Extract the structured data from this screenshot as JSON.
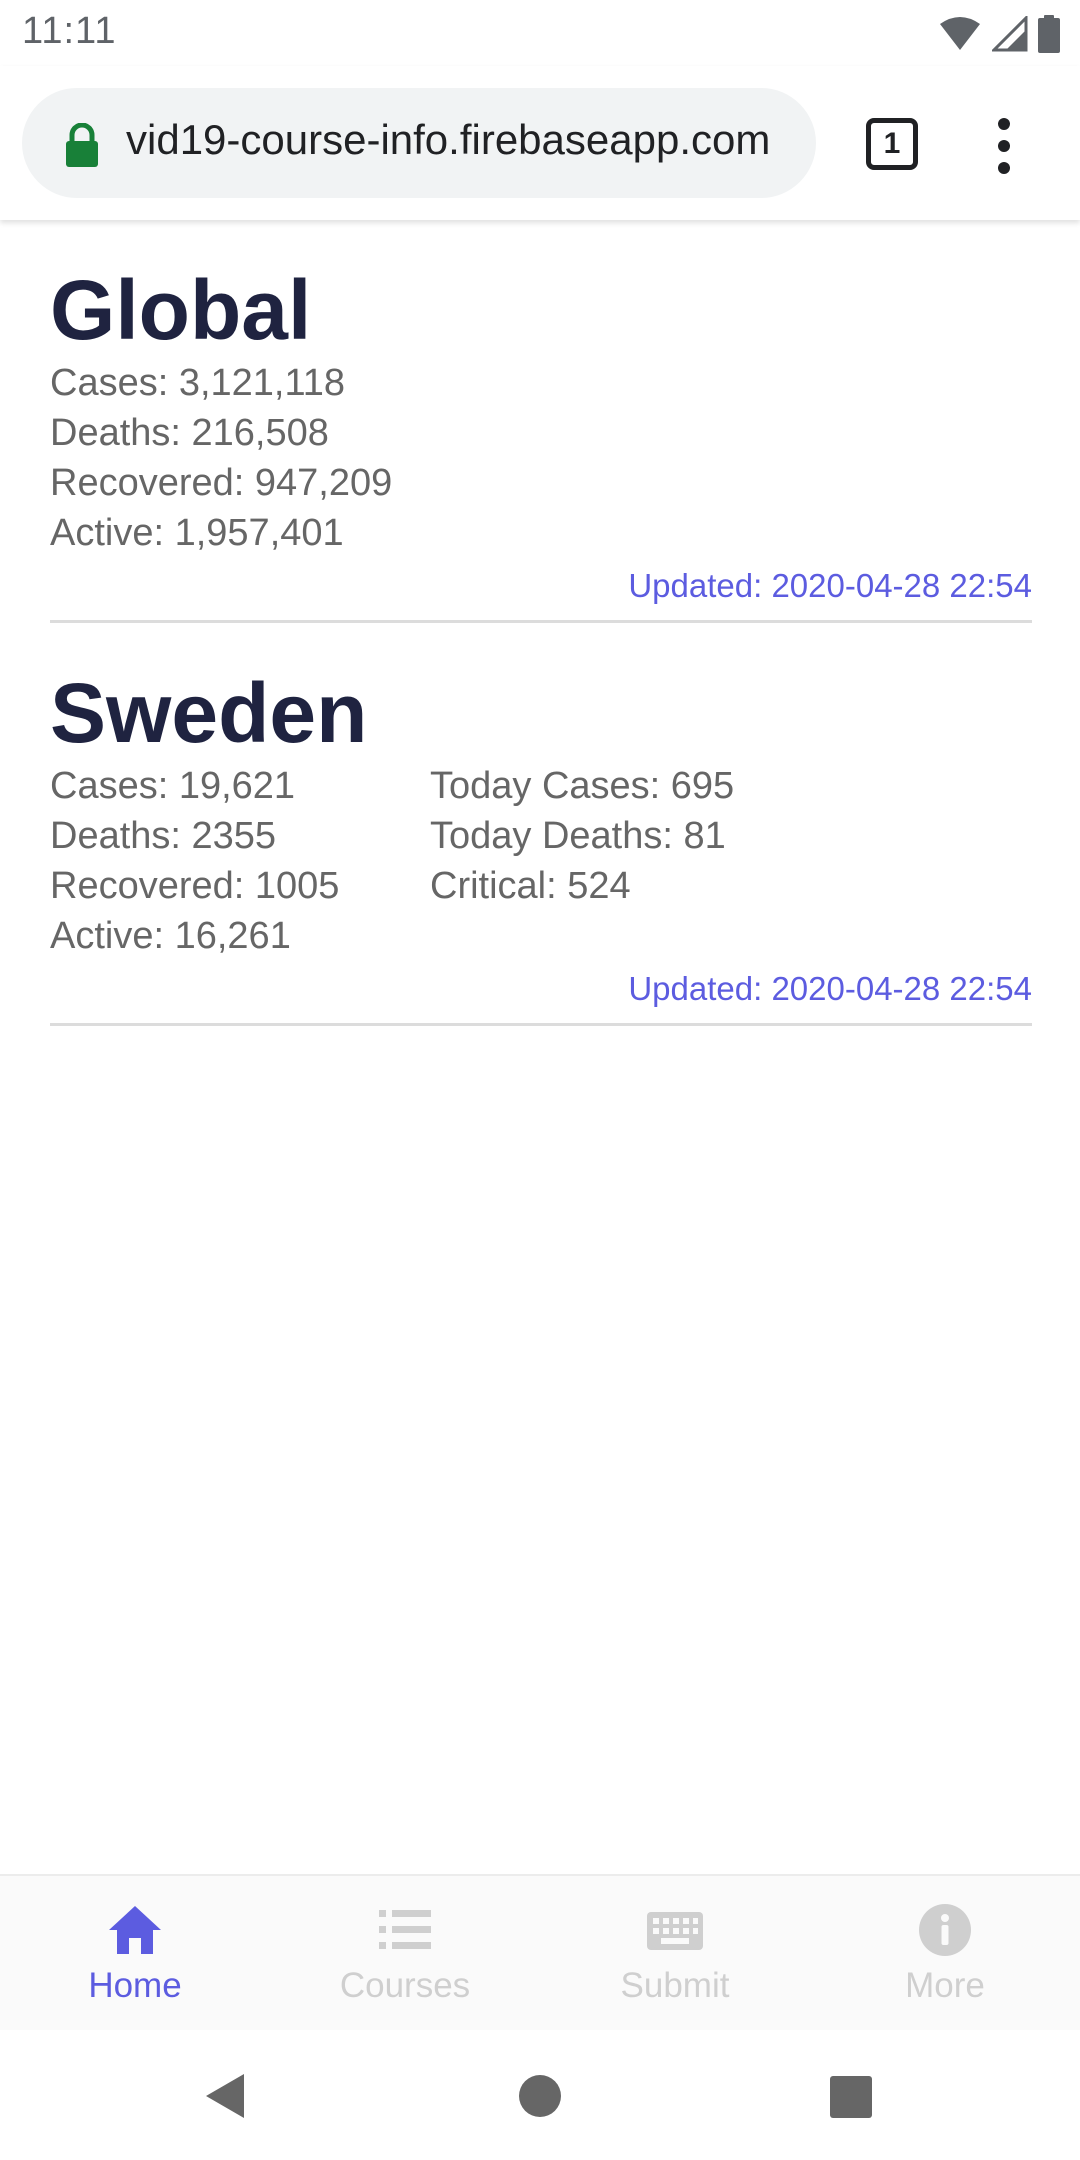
{
  "status_bar": {
    "time": "11:11"
  },
  "browser": {
    "url": "vid19-course-info.firebaseapp.com",
    "tab_count": "1"
  },
  "sections": [
    {
      "title": "Global",
      "left": [
        "Cases: 3,121,118",
        "Deaths: 216,508",
        "Recovered: 947,209",
        "Active: 1,957,401"
      ],
      "right": [],
      "updated": "Updated: 2020-04-28 22:54"
    },
    {
      "title": "Sweden",
      "left": [
        "Cases: 19,621",
        "Deaths: 2355",
        "Recovered: 1005",
        "Active: 16,261"
      ],
      "right": [
        "Today Cases: 695",
        "Today Deaths: 81",
        "Critical: 524"
      ],
      "updated": "Updated: 2020-04-28 22:54"
    }
  ],
  "bottom_nav": [
    {
      "label": "Home",
      "icon": "home-icon",
      "active": true
    },
    {
      "label": "Courses",
      "icon": "list-icon",
      "active": false
    },
    {
      "label": "Submit",
      "icon": "keyboard-icon",
      "active": false
    },
    {
      "label": "More",
      "icon": "info-icon",
      "active": false
    }
  ],
  "colors": {
    "accent": "#5c5ce0",
    "title": "#1f2340",
    "text": "#666666",
    "inactive_nav": "#cfcfcf",
    "lock": "#188038"
  }
}
